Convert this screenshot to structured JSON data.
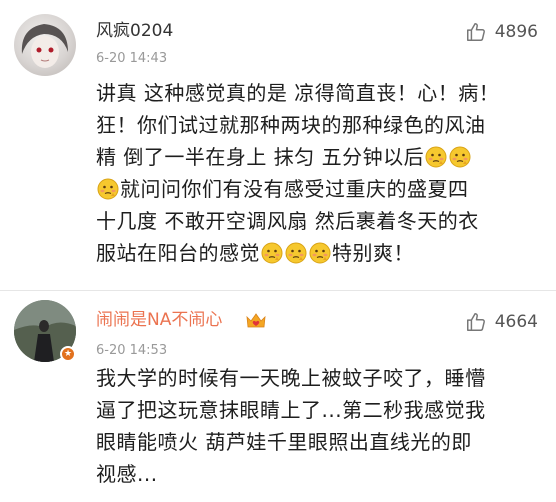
{
  "comments": [
    {
      "username": "风疯0204",
      "time": "6-20 14:43",
      "likes": "4896",
      "lines": [
        "讲真 这种感觉真的是 凉得简直丧！心！病！",
        "狂！你们试过就那种两块的那种绿色的风油",
        "精 倒了一半在身上 抹匀 五分钟以后",
        "就问问你们有没有感受过重庆的盛夏四",
        "十几度 不敢开空调风扇 然后裹着冬天的衣",
        "服站在阳台的感觉",
        "特别爽！"
      ]
    },
    {
      "username": "闹闹是NA不闹心",
      "time": "6-20 14:53",
      "likes": "4664",
      "badge": "★",
      "lines": [
        "我大学的时候有一天晚上被蚊子咬了，睡懵",
        "逼了把这玩意抹眼睛上了...第二秒我感觉我",
        "眼睛能喷火 葫芦娃千里眼照出直线光的即",
        "视感..."
      ]
    }
  ],
  "icons": {
    "like": "thumbs-up-icon",
    "emoji": "embarrassed-face-icon",
    "crown": "heart-crown-icon"
  },
  "colors": {
    "highlight_name": "#eb7350",
    "meta": "#999999",
    "badge": "#e2711d"
  }
}
